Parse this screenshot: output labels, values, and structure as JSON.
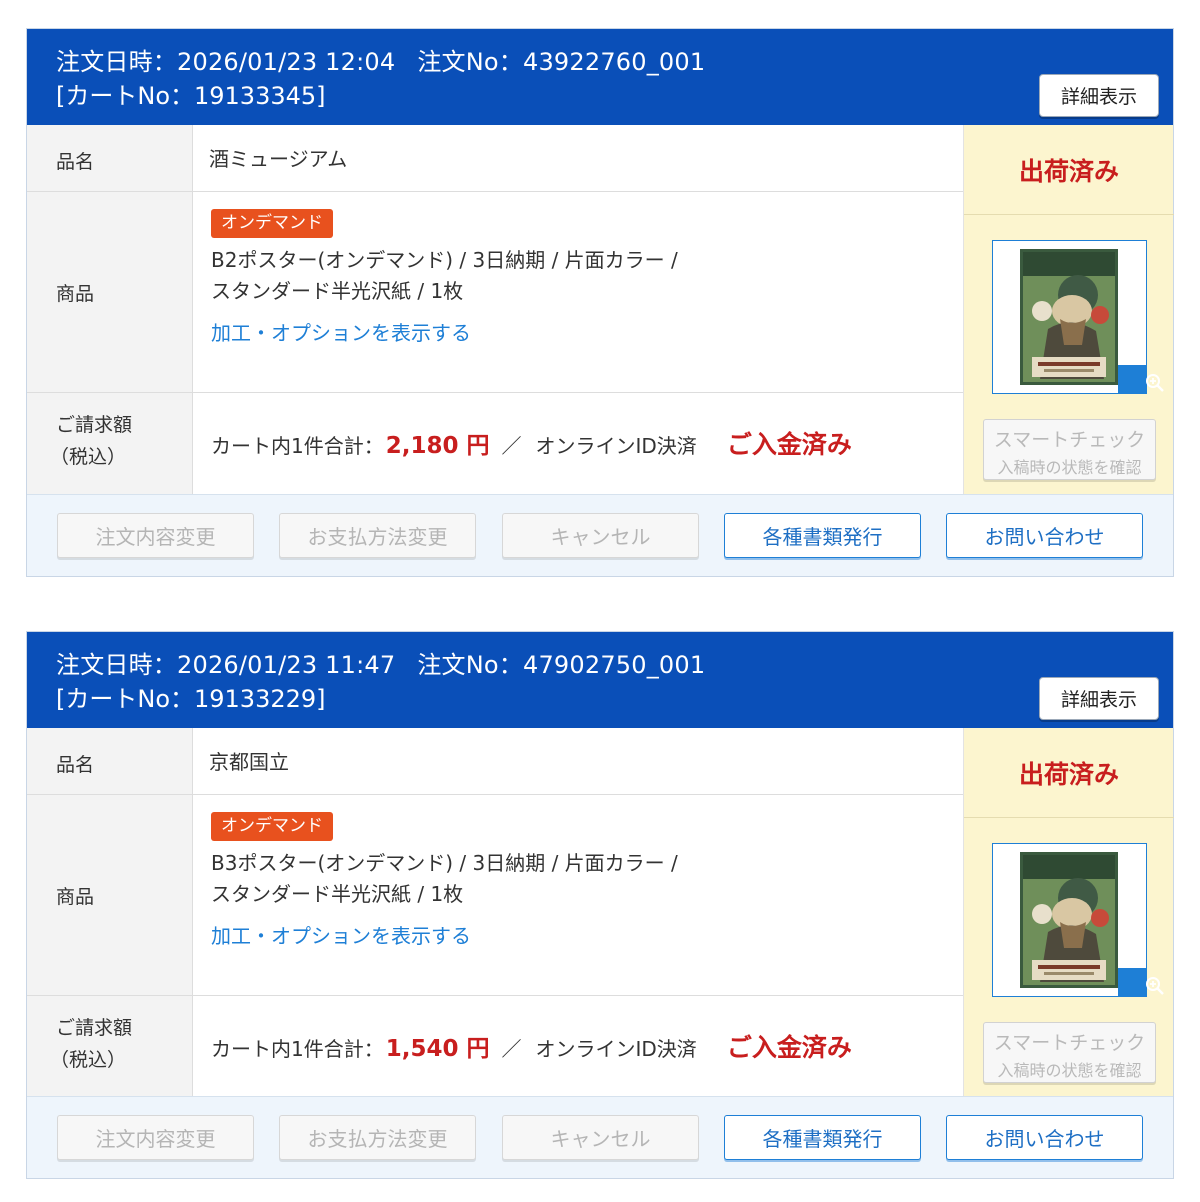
{
  "orders": [
    {
      "header": {
        "order_date_label": "注文日時：",
        "order_date": "2026/01/23 12:04",
        "order_no_label": "注文No：",
        "order_no": "43922760_001",
        "cart_no": "[カートNo：19133345]",
        "detail_button": "詳細表示"
      },
      "labels": {
        "name": "品名",
        "product": "商品",
        "billing_1": "ご請求額",
        "billing_2": "（税込）"
      },
      "item_name": "酒ミュージアム",
      "badge": "オンデマンド",
      "product_line1": "B2ポスター(オンデマンド) / 3日納期 / 片面カラー /",
      "product_line2": "スタンダード半光沢紙 / 1枚",
      "options_link": "加工・オプションを表示する",
      "billing": {
        "prefix": "カート内1件合計：",
        "amount": "2,180 円",
        "separator": "／",
        "method": "オンラインID決済",
        "payment_status": "ご入金済み"
      },
      "ship_status": "出荷済み",
      "smart_check": {
        "line1": "スマートチェック",
        "line2": "入稿時の状態を確認"
      },
      "actions": {
        "change_order": "注文内容変更",
        "change_payment": "お支払方法変更",
        "cancel": "キャンセル",
        "documents": "各種書類発行",
        "inquiry": "お問い合わせ"
      },
      "thumbnail_icon": "zoom-in-icon"
    },
    {
      "header": {
        "order_date_label": "注文日時：",
        "order_date": "2026/01/23 11:47",
        "order_no_label": "注文No：",
        "order_no": "47902750_001",
        "cart_no": "[カートNo：19133229]",
        "detail_button": "詳細表示"
      },
      "labels": {
        "name": "品名",
        "product": "商品",
        "billing_1": "ご請求額",
        "billing_2": "（税込）"
      },
      "item_name": "京都国立",
      "badge": "オンデマンド",
      "product_line1": "B3ポスター(オンデマンド) / 3日納期 / 片面カラー /",
      "product_line2": "スタンダード半光沢紙 / 1枚",
      "options_link": "加工・オプションを表示する",
      "billing": {
        "prefix": "カート内1件合計：",
        "amount": "1,540 円",
        "separator": "／",
        "method": "オンラインID決済",
        "payment_status": "ご入金済み"
      },
      "ship_status": "出荷済み",
      "smart_check": {
        "line1": "スマートチェック",
        "line2": "入稿時の状態を確認"
      },
      "actions": {
        "change_order": "注文内容変更",
        "change_payment": "お支払方法変更",
        "cancel": "キャンセル",
        "documents": "各種書類発行",
        "inquiry": "お問い合わせ"
      },
      "thumbnail_icon": "zoom-in-icon"
    }
  ],
  "colors": {
    "header_bg": "#0a4fb8",
    "status_red": "#c81e1e",
    "link_blue": "#1e7fd6",
    "badge_orange": "#e8511e",
    "status_cell_bg": "#fcf5cf",
    "footer_bg": "#eef5fc"
  }
}
